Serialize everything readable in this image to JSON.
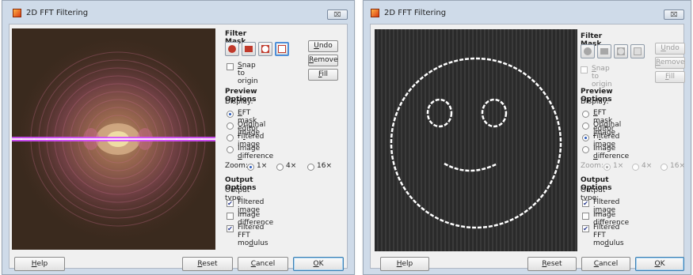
{
  "windows": [
    {
      "title": "2D FFT Filtering",
      "close_glyph": "⌧",
      "filter_mask": {
        "heading": "Filter Mask",
        "undo": "Undo",
        "undo_key": "U",
        "undo_rest": "ndo",
        "remove": "Remove",
        "remove_key": "R",
        "remove_rest": "emove",
        "fill": "Fill",
        "fill_key": "F",
        "fill_rest": "ill",
        "snap_pre": "",
        "snap_key": "S",
        "snap_rest": "nap to origin",
        "snap_checked": false
      },
      "preview_options": {
        "heading": "Preview Options",
        "display_label": "Display:",
        "options": [
          {
            "pre": "",
            "key": "E",
            "rest": "FT mask editor",
            "selected": true
          },
          {
            "pre": "Original ",
            "key": "i",
            "rest": "mage",
            "selected": false
          },
          {
            "pre": "Fi",
            "key": "l",
            "rest": "tered image",
            "selected": false
          },
          {
            "pre": "Image ",
            "key": "d",
            "rest": "ifference",
            "selected": false
          }
        ],
        "zoom_label": "Zoom:",
        "zoom": [
          {
            "label": "1×",
            "selected": true
          },
          {
            "label": "4×",
            "selected": false
          },
          {
            "label": "16×",
            "selected": false
          }
        ]
      },
      "output_options": {
        "heading": "Output Options",
        "type_label": "Output type:",
        "items": [
          {
            "pre": "Filtered i",
            "key": "m",
            "rest": "age",
            "checked": true
          },
          {
            "pre": "Image difference",
            "key": "",
            "rest": "",
            "checked": false
          },
          {
            "pre": "Filtered FFT mo",
            "key": "d",
            "rest": "ulus",
            "checked": true
          }
        ]
      },
      "buttons": {
        "help_key": "H",
        "help_rest": "elp",
        "reset_key": "R",
        "reset_rest": "eset",
        "cancel_key": "C",
        "cancel_rest": "ancel",
        "ok_key": "O",
        "ok_rest": "K"
      }
    },
    {
      "title": "2D FFT Filtering",
      "close_glyph": "⌧",
      "filter_mask": {
        "heading": "Filter Mask",
        "undo": "Undo",
        "undo_key": "U",
        "undo_rest": "ndo",
        "remove": "Remove",
        "remove_key": "R",
        "remove_rest": "emove",
        "fill": "Fill",
        "fill_key": "F",
        "fill_rest": "ill",
        "snap_pre": "",
        "snap_key": "S",
        "snap_rest": "nap to origin",
        "snap_checked": false
      },
      "preview_options": {
        "heading": "Preview Options",
        "display_label": "Display:",
        "options": [
          {
            "pre": "",
            "key": "E",
            "rest": "FT mask editor",
            "selected": false
          },
          {
            "pre": "Original ",
            "key": "i",
            "rest": "mage",
            "selected": false
          },
          {
            "pre": "Fi",
            "key": "l",
            "rest": "tered image",
            "selected": true
          },
          {
            "pre": "Image ",
            "key": "d",
            "rest": "ifference",
            "selected": false
          }
        ],
        "zoom_label": "Zoom:",
        "zoom": [
          {
            "label": "1×",
            "selected": true
          },
          {
            "label": "4×",
            "selected": false
          },
          {
            "label": "16×",
            "selected": false
          }
        ]
      },
      "output_options": {
        "heading": "Output Options",
        "type_label": "Output type:",
        "items": [
          {
            "pre": "Filtered i",
            "key": "m",
            "rest": "age",
            "checked": true
          },
          {
            "pre": "Image difference",
            "key": "",
            "rest": "",
            "checked": false
          },
          {
            "pre": "Filtered FFT mo",
            "key": "d",
            "rest": "ulus",
            "checked": true
          }
        ]
      },
      "buttons": {
        "help_key": "H",
        "help_rest": "elp",
        "reset_key": "R",
        "reset_rest": "eset",
        "cancel_key": "C",
        "cancel_rest": "ancel",
        "ok_key": "O",
        "ok_rest": "K"
      }
    }
  ],
  "colors": {
    "accent": "#4f8fd8",
    "mask_red": "#c0392b",
    "spectrum_core": "#d8b08a",
    "line_magenta": "#d44fff"
  },
  "check_glyph": "✔"
}
